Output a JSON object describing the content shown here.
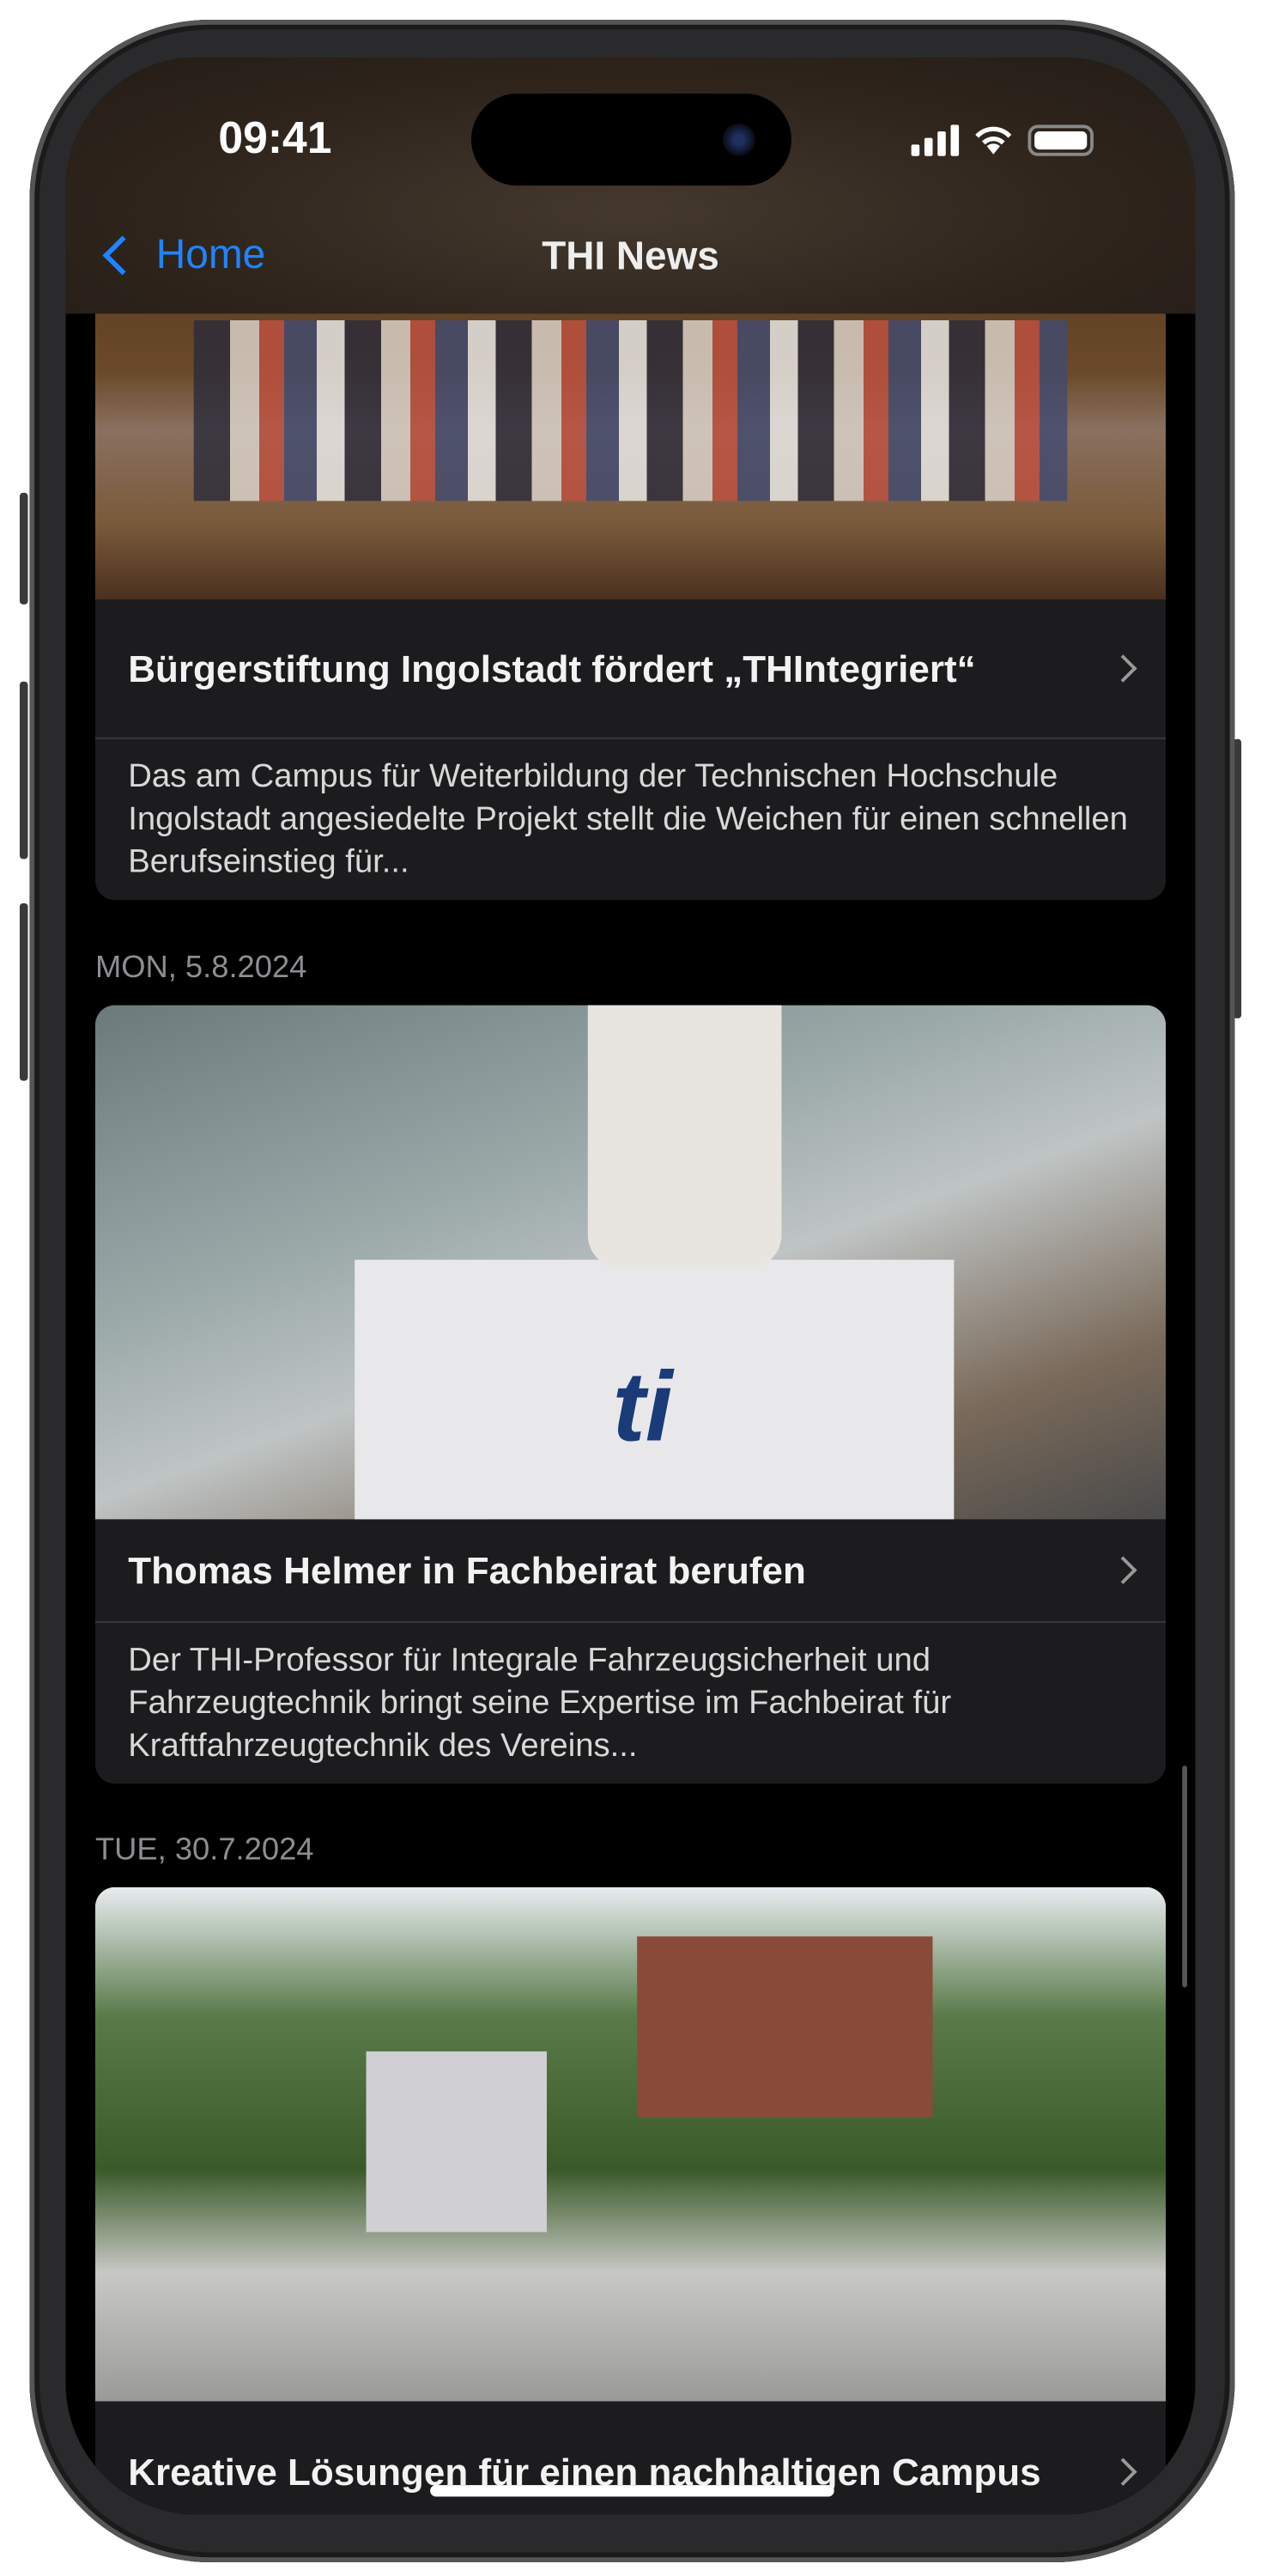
{
  "status_bar": {
    "time": "09:41"
  },
  "nav": {
    "back_label": "Home",
    "title": "THI News"
  },
  "news": [
    {
      "title": "Bürgerstiftung Ingolstadt fördert „THIntegriert“",
      "description": "Das am Campus für Weiterbildung der Technischen Hochschule Ingolstadt angesiedelte Projekt stellt die Weichen für einen schnellen Berufseinstieg für..."
    },
    {
      "date": "MON, 5.8.2024",
      "title": "Thomas Helmer in Fachbeirat berufen",
      "description": "Der THI-Professor für Integrale Fahrzeugsicherheit und Fahrzeugtechnik bringt seine Expertise im Fachbeirat für Kraftfahrzeugtechnik des Vereins..."
    },
    {
      "date": "TUE, 30.7.2024",
      "title": "Kreative Lösungen für einen nachhaltigen Campus"
    }
  ],
  "colors": {
    "accent": "#1f84ff",
    "card": "#1c1c1e"
  }
}
